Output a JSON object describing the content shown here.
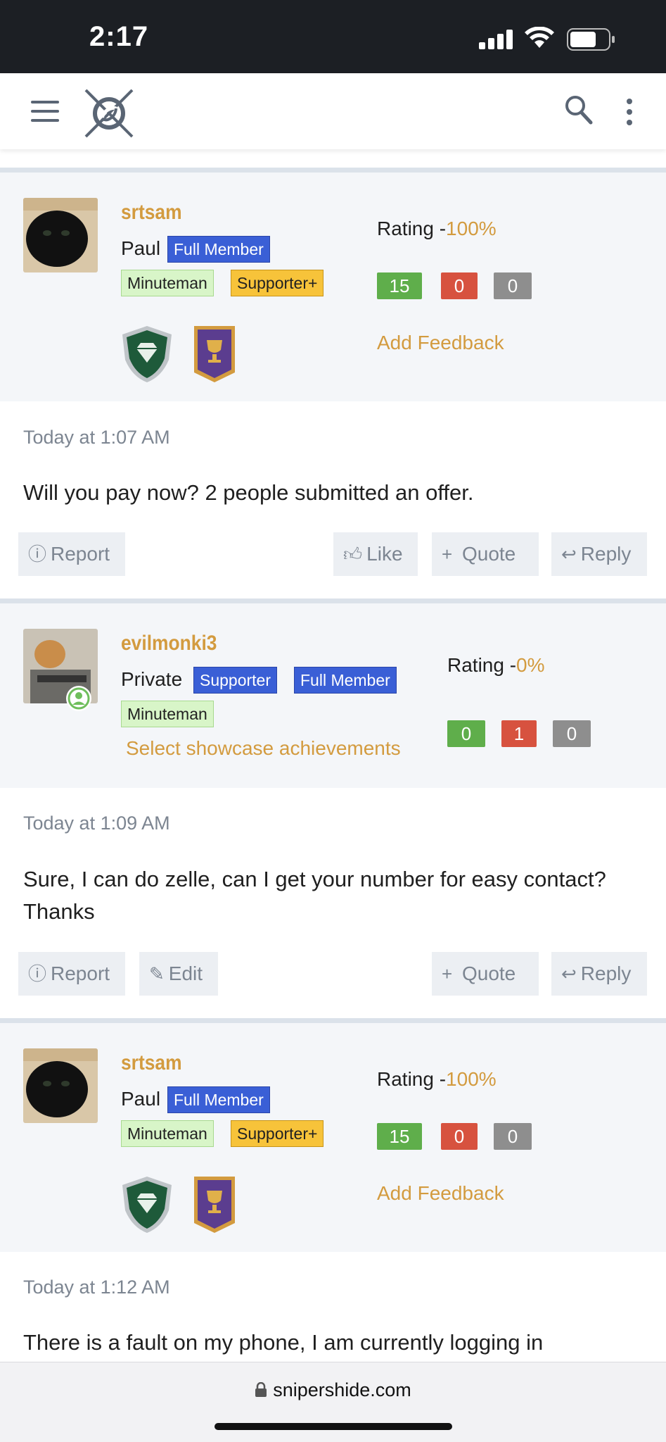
{
  "status_bar": {
    "time": "2:17"
  },
  "header": {
    "logo_icon": "sniper-crosshair-logo",
    "menu_icon": "hamburger-icon",
    "search_icon": "search-icon",
    "more_icon": "vertical-dots-icon"
  },
  "posts": [
    {
      "username": "srtsam",
      "realname": "Paul",
      "badges": [
        "Full Member",
        "Minuteman",
        "Supporter+"
      ],
      "rating_label": "Rating -",
      "rating_value": "100%",
      "counts": [
        "15",
        "0",
        "0"
      ],
      "feedback_link": "Add Feedback",
      "timestamp": "Today at 1:07 AM",
      "message": "Will you pay now? 2 people submitted an offer.",
      "actions": {
        "report": "Report",
        "like": "Like",
        "quote": "Quote",
        "reply": "Reply"
      }
    },
    {
      "username": "evilmonki3",
      "realname": "Private",
      "badges": [
        "Supporter",
        "Full Member",
        "Minuteman"
      ],
      "showcase_link": "Select showcase achievements",
      "rating_label": "Rating -",
      "rating_value": "0%",
      "counts": [
        "0",
        "1",
        "0"
      ],
      "timestamp": "Today at 1:09 AM",
      "message": "Sure, I can do zelle, can I get your number for easy contact? Thanks",
      "actions": {
        "report": "Report",
        "edit": "Edit",
        "quote": "Quote",
        "reply": "Reply"
      }
    },
    {
      "username": "srtsam",
      "realname": "Paul",
      "badges": [
        "Full Member",
        "Minuteman",
        "Supporter+"
      ],
      "rating_label": "Rating -",
      "rating_value": "100%",
      "counts": [
        "15",
        "0",
        "0"
      ],
      "feedback_link": "Add Feedback",
      "timestamp": "Today at 1:12 AM",
      "message": "There is a fault on my phone, I am currently logging in"
    }
  ],
  "url_bar": {
    "url": "snipershide.com",
    "lock_icon": "lock-icon"
  },
  "colors": {
    "accent": "#d39b3f",
    "badge_blue": "#3a5fd6",
    "badge_green": "#d8f5c8",
    "badge_yellow": "#f7c33a",
    "positive": "#5fae4b",
    "negative": "#d7523f",
    "neutral": "#8e8e8e"
  }
}
